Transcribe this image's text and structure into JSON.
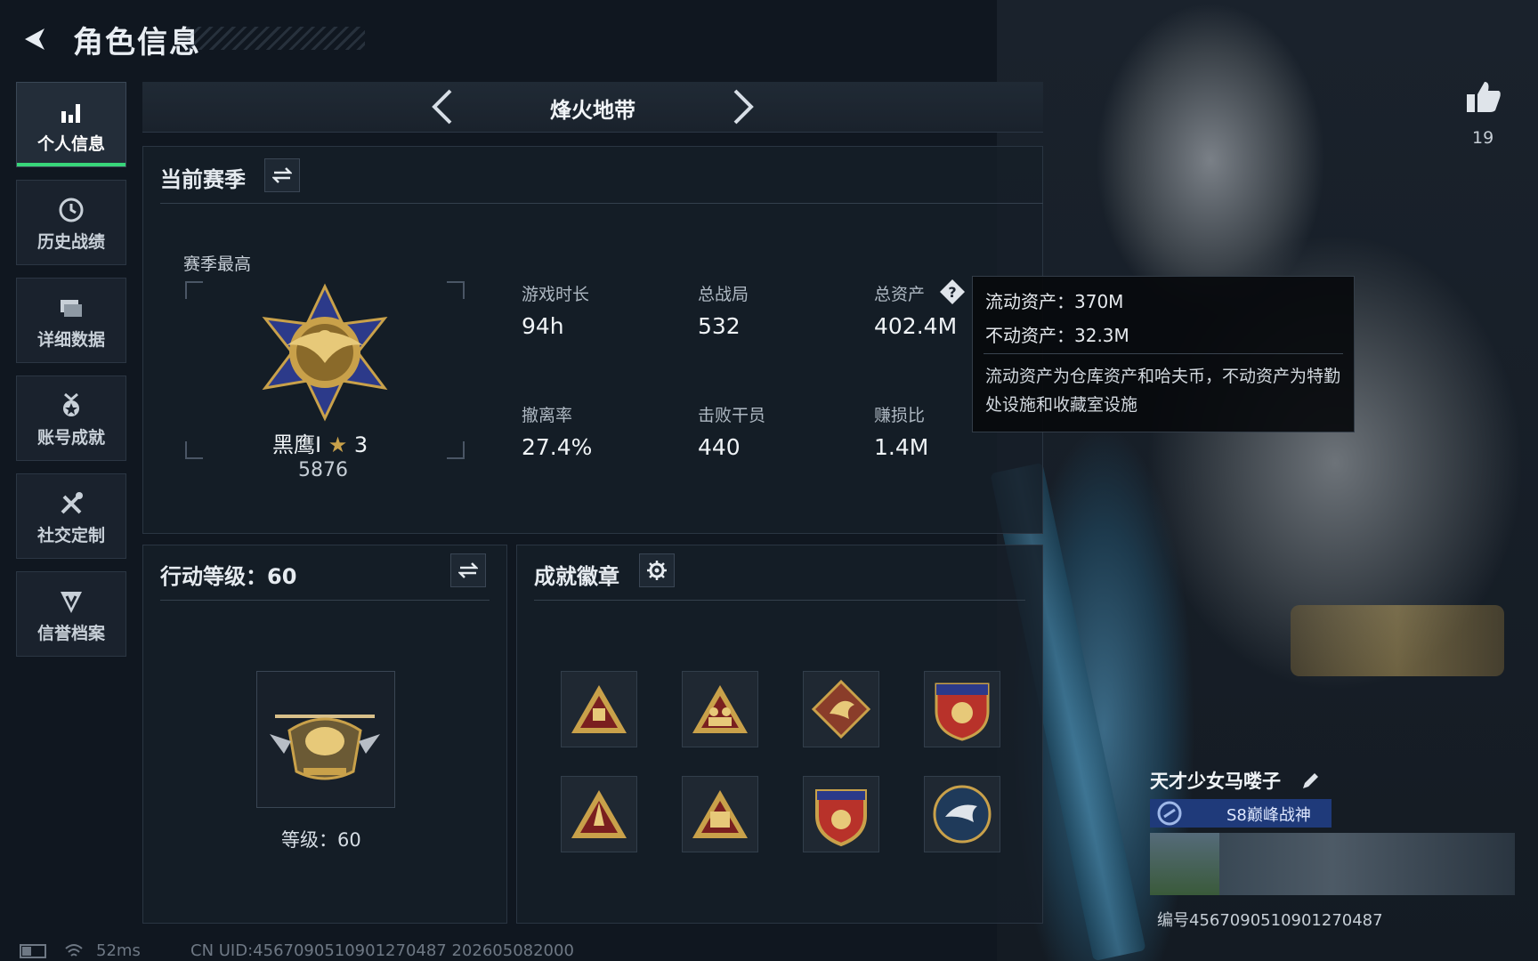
{
  "header": {
    "title": "角色信息"
  },
  "sidebar": {
    "items": [
      {
        "label": "个人信息",
        "icon": "bar-chart-icon",
        "active": true
      },
      {
        "label": "历史战绩",
        "icon": "clock-icon",
        "active": false
      },
      {
        "label": "详细数据",
        "icon": "folder-icon",
        "active": false
      },
      {
        "label": "账号成就",
        "icon": "medal-icon",
        "active": false
      },
      {
        "label": "社交定制",
        "icon": "tools-icon",
        "active": false
      },
      {
        "label": "信誉档案",
        "icon": "shield-icon",
        "active": false
      }
    ]
  },
  "mode": {
    "title": "烽火地带"
  },
  "season": {
    "title": "当前赛季",
    "best_label": "赛季最高",
    "rank_name": "黑鹰I",
    "rank_stars": "3",
    "rank_points": "5876",
    "stats": [
      {
        "label": "游戏时长",
        "value": "94h"
      },
      {
        "label": "总战局",
        "value": "532"
      },
      {
        "label": "总资产",
        "value": "402.4M"
      },
      {
        "label": "撤离率",
        "value": "27.4%"
      },
      {
        "label": "击败干员",
        "value": "440"
      },
      {
        "label": "赚损比",
        "value": "1.4M"
      }
    ]
  },
  "tooltip": {
    "liquid": "流动资产：370M",
    "fixed": "不动资产：32.3M",
    "desc": "流动资产为仓库资产和哈夫币，不动资产为特勤处设施和收藏室设施"
  },
  "action_level": {
    "title": "行动等级：60",
    "level_text": "等级：60"
  },
  "achievements": {
    "title": "成就徽章"
  },
  "likes": {
    "count": "19"
  },
  "player": {
    "name": "天才少女马喽子",
    "title": "S8巅峰战神",
    "id": "编号4567090510901270487"
  },
  "status": {
    "ping": "52ms",
    "uid": "CN UID:4567090510901270487 202605082000"
  },
  "colors": {
    "accent_green": "#38d67a",
    "gold": "#c9a14a"
  }
}
